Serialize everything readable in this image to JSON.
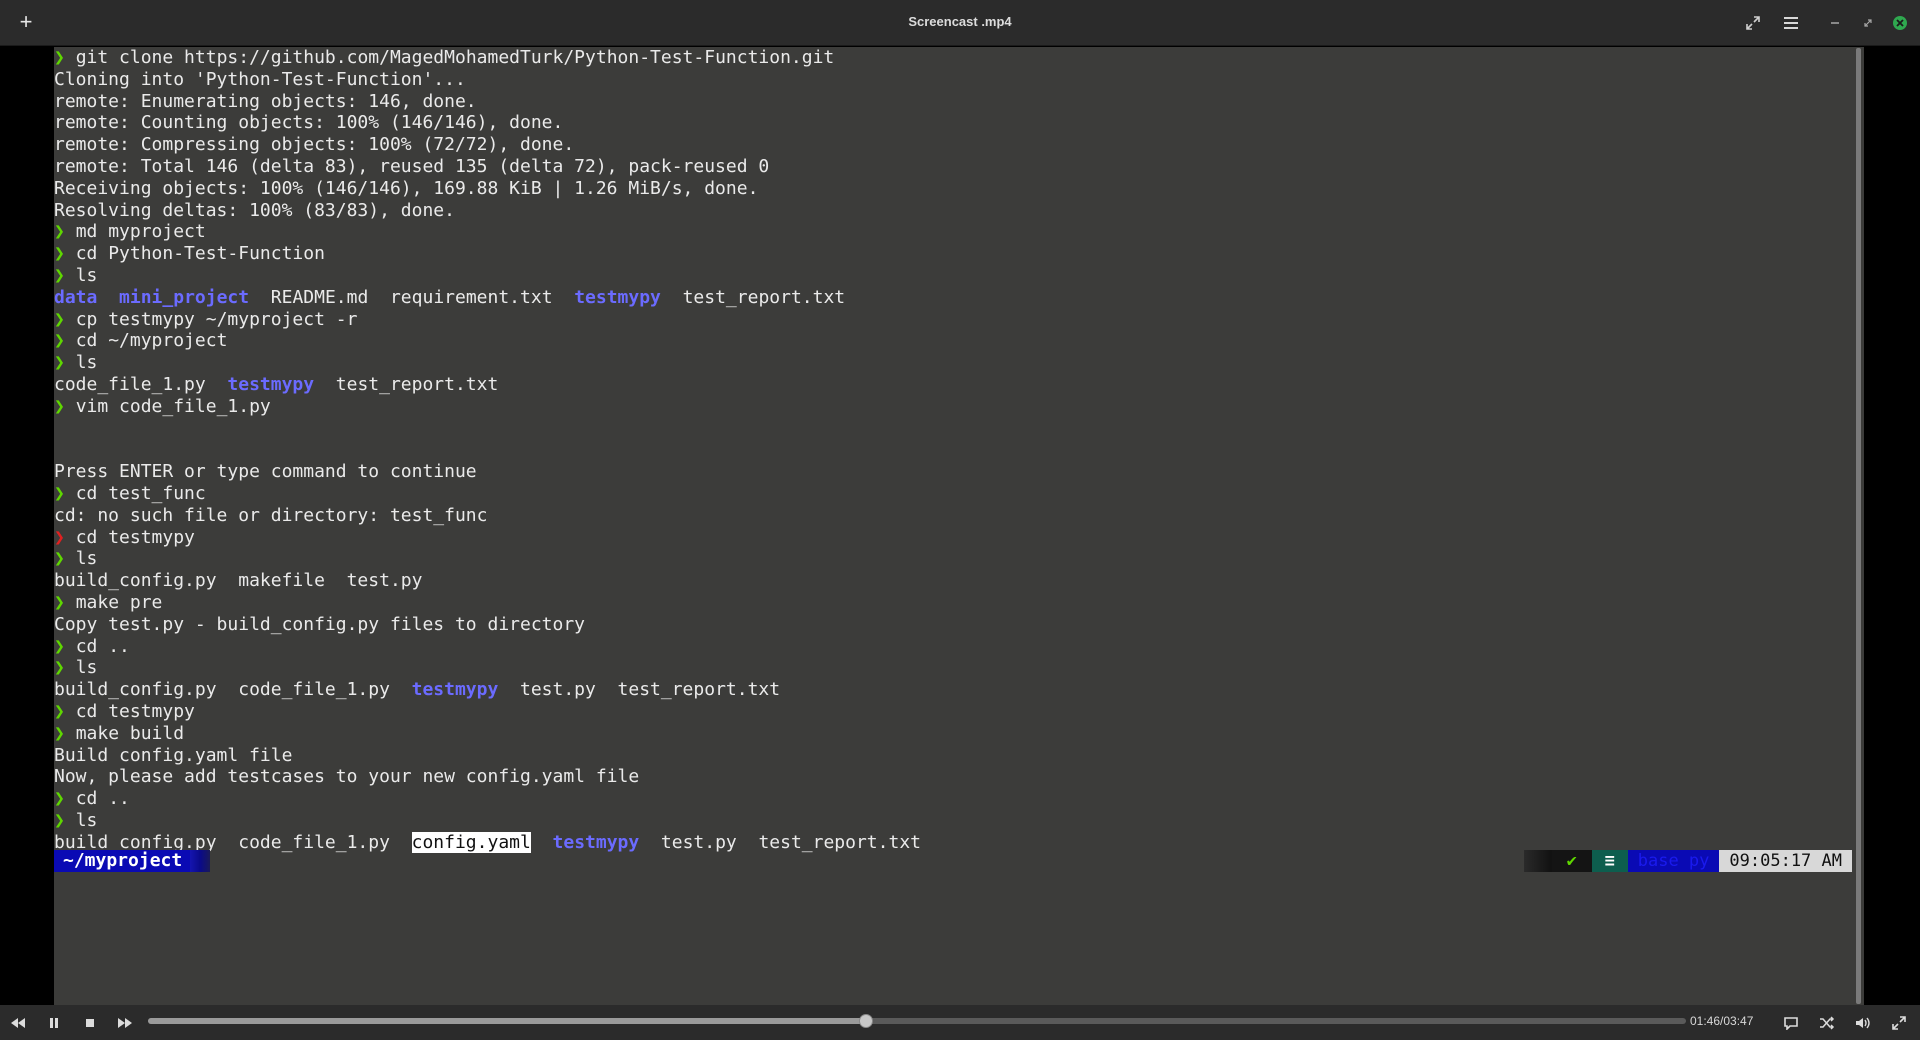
{
  "window": {
    "title": "Screencast .mp4",
    "add_icon": "+"
  },
  "terminal": {
    "prompt_char": "❯",
    "lines": [
      [
        {
          "t": "p"
        },
        {
          "t": "n",
          "v": "git clone https://github.com/MagedMohamedTurk/Python-Test-Function.git"
        }
      ],
      [
        {
          "t": "n",
          "v": "Cloning into 'Python-Test-Function'..."
        }
      ],
      [
        {
          "t": "n",
          "v": "remote: Enumerating objects: 146, done."
        }
      ],
      [
        {
          "t": "n",
          "v": "remote: Counting objects: 100% (146/146), done."
        }
      ],
      [
        {
          "t": "n",
          "v": "remote: Compressing objects: 100% (72/72), done."
        }
      ],
      [
        {
          "t": "n",
          "v": "remote: Total 146 (delta 83), reused 135 (delta 72), pack-reused 0"
        }
      ],
      [
        {
          "t": "n",
          "v": "Receiving objects: 100% (146/146), 169.88 KiB | 1.26 MiB/s, done."
        }
      ],
      [
        {
          "t": "n",
          "v": "Resolving deltas: 100% (83/83), done."
        }
      ],
      [
        {
          "t": "p"
        },
        {
          "t": "n",
          "v": "md myproject"
        }
      ],
      [
        {
          "t": "p"
        },
        {
          "t": "n",
          "v": "cd Python-Test-Function"
        }
      ],
      [
        {
          "t": "p"
        },
        {
          "t": "n",
          "v": "ls"
        }
      ],
      [
        {
          "t": "d",
          "v": "data"
        },
        {
          "t": "n",
          "v": "  "
        },
        {
          "t": "d",
          "v": "mini_project"
        },
        {
          "t": "n",
          "v": "  README.md  requirement.txt  "
        },
        {
          "t": "d",
          "v": "testmypy"
        },
        {
          "t": "n",
          "v": "  test_report.txt"
        }
      ],
      [
        {
          "t": "p"
        },
        {
          "t": "n",
          "v": "cp testmypy ~/myproject -r"
        }
      ],
      [
        {
          "t": "p"
        },
        {
          "t": "n",
          "v": "cd ~/myproject"
        }
      ],
      [
        {
          "t": "p"
        },
        {
          "t": "n",
          "v": "ls"
        }
      ],
      [
        {
          "t": "n",
          "v": "code_file_1.py  "
        },
        {
          "t": "d",
          "v": "testmypy"
        },
        {
          "t": "n",
          "v": "  test_report.txt"
        }
      ],
      [
        {
          "t": "p"
        },
        {
          "t": "n",
          "v": "vim code_file_1.py"
        }
      ],
      [],
      [],
      [
        {
          "t": "n",
          "v": "Press ENTER or type command to continue"
        }
      ],
      [
        {
          "t": "p"
        },
        {
          "t": "n",
          "v": "cd test_func"
        }
      ],
      [
        {
          "t": "n",
          "v": "cd: no such file or directory: test_func"
        }
      ],
      [
        {
          "t": "e"
        },
        {
          "t": "n",
          "v": "cd testmypy"
        }
      ],
      [
        {
          "t": "p"
        },
        {
          "t": "n",
          "v": "ls"
        }
      ],
      [
        {
          "t": "n",
          "v": "build_config.py  makefile  test.py"
        }
      ],
      [
        {
          "t": "p"
        },
        {
          "t": "n",
          "v": "make pre"
        }
      ],
      [
        {
          "t": "n",
          "v": "Copy test.py - build_config.py files to directory"
        }
      ],
      [
        {
          "t": "p"
        },
        {
          "t": "n",
          "v": "cd .."
        }
      ],
      [
        {
          "t": "p"
        },
        {
          "t": "n",
          "v": "ls"
        }
      ],
      [
        {
          "t": "n",
          "v": "build_config.py  code_file_1.py  "
        },
        {
          "t": "d",
          "v": "testmypy"
        },
        {
          "t": "n",
          "v": "  test.py  test_report.txt"
        }
      ],
      [
        {
          "t": "p"
        },
        {
          "t": "n",
          "v": "cd testmypy"
        }
      ],
      [
        {
          "t": "p"
        },
        {
          "t": "n",
          "v": "make build"
        }
      ],
      [
        {
          "t": "n",
          "v": "Build config.yaml file"
        }
      ],
      [
        {
          "t": "n",
          "v": "Now, please add testcases to your new config.yaml file"
        }
      ],
      [
        {
          "t": "p"
        },
        {
          "t": "n",
          "v": "cd .."
        }
      ],
      [
        {
          "t": "p"
        },
        {
          "t": "n",
          "v": "ls"
        }
      ],
      [
        {
          "t": "n",
          "v": "build_config.py  code_file_1.py  "
        },
        {
          "t": "h",
          "v": "config.yaml"
        },
        {
          "t": "n",
          "v": "  "
        },
        {
          "t": "d",
          "v": "testmypy"
        },
        {
          "t": "n",
          "v": "  test.py  test_report.txt"
        }
      ]
    ],
    "cwd": "~/myproject",
    "right_prompt": {
      "status": "✔",
      "menu": "≡",
      "env": "base py",
      "time": "09:05:17 AM"
    }
  },
  "player": {
    "time_display": "01:46/03:47",
    "progress_fraction": 0.4669
  },
  "colors": {
    "prompt_ok": "#5fd700",
    "prompt_err": "#e02020",
    "directory": "#6b6bff",
    "terminal_bg": "#3c3c3a"
  }
}
